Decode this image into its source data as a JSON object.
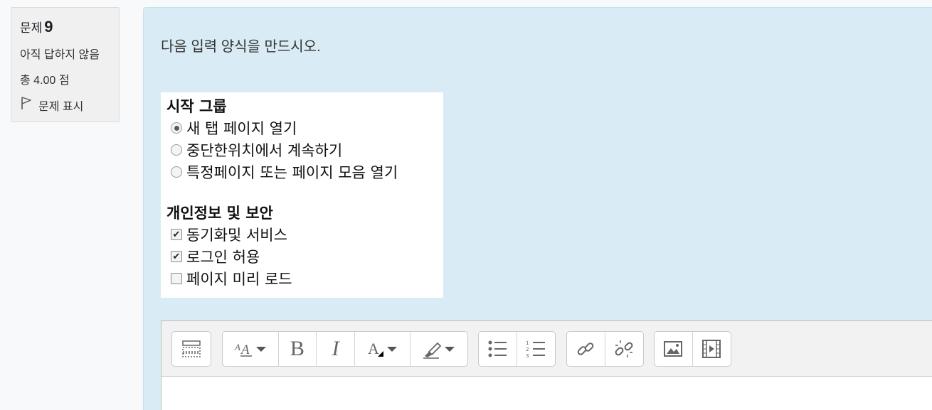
{
  "info": {
    "question_label": "문제",
    "question_number": "9",
    "status": "아직 답하지 않음",
    "mark": "총 4.00 점",
    "flag_label": "문제 표시"
  },
  "question": {
    "text": "다음 입력 양식을 만드시오."
  },
  "image": {
    "group1_title": "시작 그룹",
    "radios": [
      {
        "label": "새 탭 페이지 열기",
        "checked": true
      },
      {
        "label": "중단한위치에서 계속하기",
        "checked": false
      },
      {
        "label": "특정페이지 또는 페이지 모음 열기",
        "checked": false
      }
    ],
    "group2_title": "개인정보 및 보안",
    "checkboxes": [
      {
        "label": "동기화및 서비스",
        "checked": true
      },
      {
        "label": "로그인 허용",
        "checked": true
      },
      {
        "label": "페이지 미리 로드",
        "checked": false
      }
    ]
  },
  "editor": {
    "toolbar": [
      "toolbar-toggle",
      "font-size",
      "bold",
      "italic",
      "font-color",
      "highlight",
      "unordered-list",
      "ordered-list",
      "link",
      "unlink",
      "image",
      "media"
    ],
    "bold_glyph": "B",
    "italic_glyph": "I",
    "content": ""
  }
}
